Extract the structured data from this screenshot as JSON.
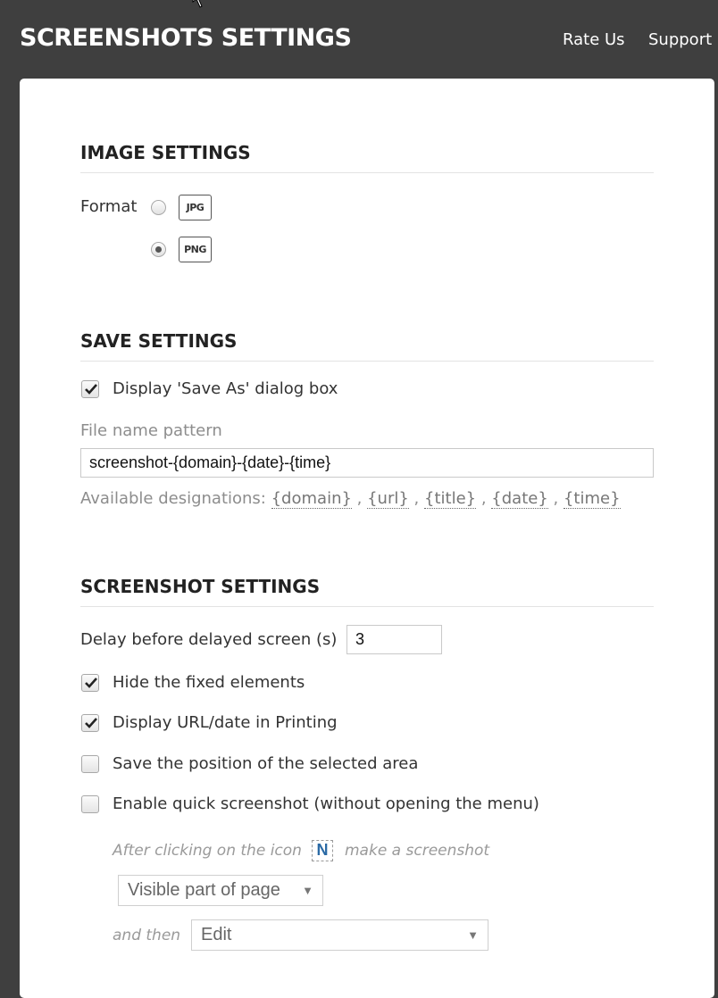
{
  "header": {
    "title": "SCREENSHOTS SETTINGS",
    "links": [
      "Rate Us",
      "Support"
    ]
  },
  "image_settings": {
    "title": "IMAGE SETTINGS",
    "format_label": "Format",
    "formats": [
      {
        "label": "JPG",
        "selected": false
      },
      {
        "label": "PNG",
        "selected": true
      }
    ]
  },
  "save_settings": {
    "title": "SAVE SETTINGS",
    "save_as_label": "Display 'Save As' dialog box",
    "save_as_checked": true,
    "pattern_label": "File name pattern",
    "pattern_value": "screenshot-{domain}-{date}-{time}",
    "designations_label": "Available designations:",
    "designations": [
      "{domain}",
      "{url}",
      "{title}",
      "{date}",
      "{time}"
    ]
  },
  "screenshot_settings": {
    "title": "SCREENSHOT SETTINGS",
    "delay_label": "Delay before delayed screen (s)",
    "delay_value": "3",
    "options": [
      {
        "label": "Hide the fixed elements",
        "checked": true
      },
      {
        "label": "Display URL/date in Printing",
        "checked": true
      },
      {
        "label": "Save the position of the selected area",
        "checked": false
      },
      {
        "label": "Enable quick screenshot (without opening the menu)",
        "checked": false
      }
    ],
    "quick": {
      "after_text": "After clicking on the icon",
      "icon_letter": "N",
      "make_text": "make a screenshot",
      "mode_value": "Visible part of page",
      "and_then_text": "and then",
      "then_value": "Edit"
    }
  },
  "colors": {
    "header_bg": "#3f3f3f",
    "card_bg": "#ffffff",
    "muted_text": "#8d8d8d"
  }
}
